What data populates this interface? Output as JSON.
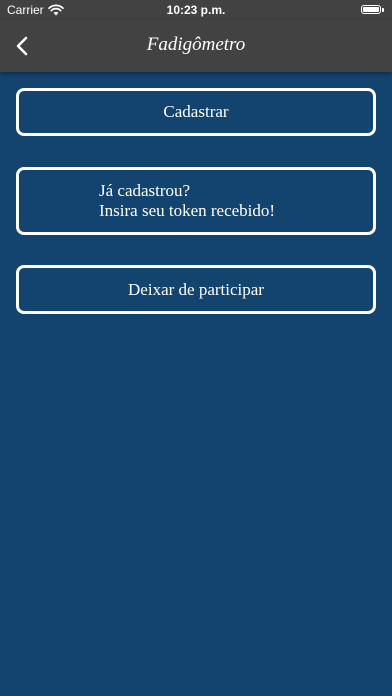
{
  "status_bar": {
    "carrier": "Carrier",
    "time": "10:23 p.m.",
    "wifi_icon": "wifi-icon",
    "battery_icon": "battery-icon",
    "battery_level": 1.0
  },
  "nav": {
    "title": "Fadigômetro",
    "back_icon": "chevron-left-icon"
  },
  "buttons": {
    "register": "Cadastrar",
    "token_line1": "Já cadastrou?",
    "token_line2": "Insira seu token recebido!",
    "leave": "Deixar de participar"
  },
  "colors": {
    "background": "#13446f",
    "bar": "#424242",
    "border": "#ffffff"
  }
}
